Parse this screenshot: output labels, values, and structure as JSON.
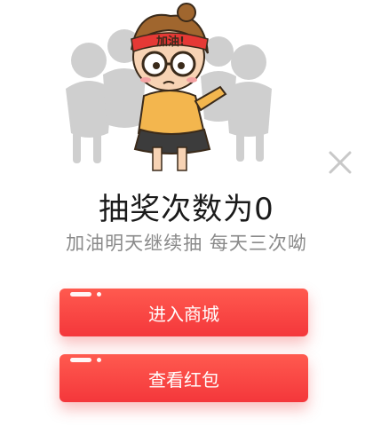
{
  "illustration": {
    "headband_text": "加油!",
    "icon": "cheering-girl-illustration"
  },
  "dialog": {
    "close_icon": "close-icon",
    "title": "抽奖次数为0",
    "subtitle": "加油明天继续抽  每天三次呦"
  },
  "buttons": {
    "enter_mall": "进入商城",
    "view_red_packet": "查看红包"
  },
  "colors": {
    "accent": "#f4373b",
    "title": "#1a1a1a",
    "subtitle": "#8a8a8a",
    "close": "#c8c8c8"
  }
}
